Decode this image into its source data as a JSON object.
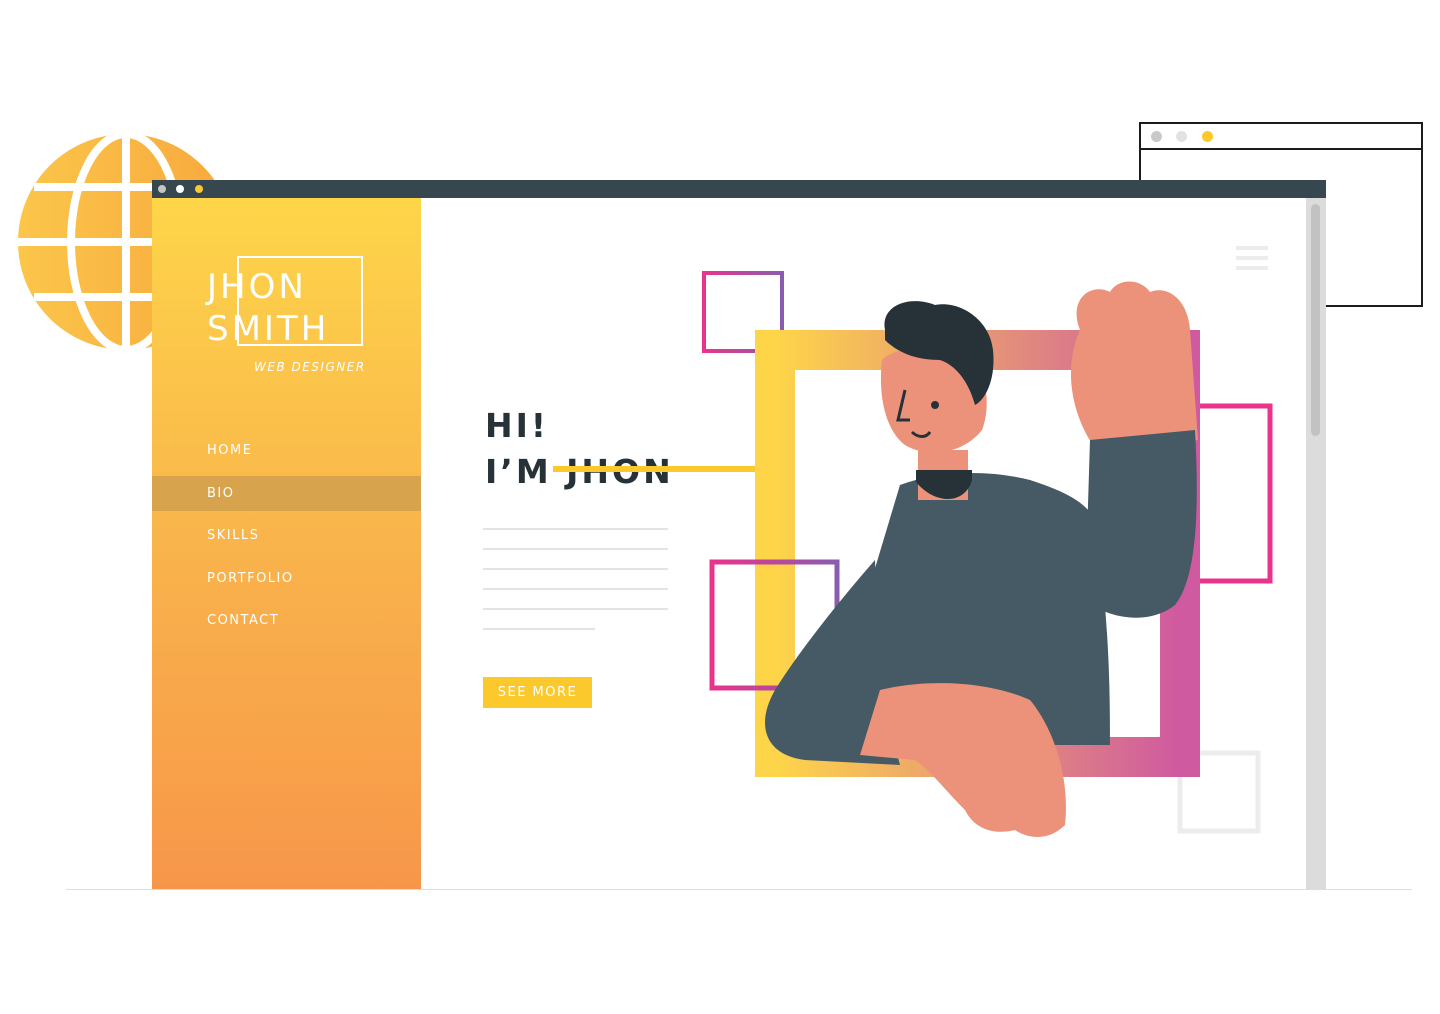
{
  "site": {
    "brand": {
      "first_name": "JHON",
      "last_name": "SMITH",
      "tagline": "WEB DESIGNER"
    },
    "nav": {
      "items": [
        {
          "label": "HOME",
          "active": false
        },
        {
          "label": "BIO",
          "active": true
        },
        {
          "label": "SKILLS",
          "active": false
        },
        {
          "label": "PORTFOLIO",
          "active": false
        },
        {
          "label": "CONTACT",
          "active": false
        }
      ]
    },
    "hero": {
      "greeting_line1": "HI!",
      "greeting_line2": "I’M JHON",
      "cta_label": "SEE MORE"
    }
  },
  "icons": [
    "globe-icon",
    "hamburger-menu-icon"
  ],
  "colors": {
    "sidebar_top": "#fed549",
    "sidebar_bottom": "#f7964a",
    "nav_active": "#d7a34d",
    "accent_yellow": "#fcc92d",
    "titlebar": "#37474f",
    "text_dark": "#263238",
    "frame_pink": "#e8348a",
    "frame_purple": "#8a5cb0"
  }
}
